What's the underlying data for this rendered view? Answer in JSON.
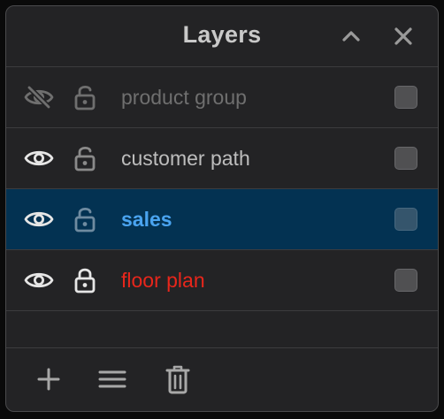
{
  "panel": {
    "title": "Layers",
    "header_icons": [
      "chevron-up-icon",
      "close-icon"
    ]
  },
  "layers": [
    {
      "name": "product group",
      "visible": false,
      "locked": false,
      "selected": false,
      "name_color": "#6f6f6f",
      "icon_color": "#6f6f6f"
    },
    {
      "name": "customer path",
      "visible": true,
      "locked": false,
      "selected": false,
      "name_color": "#bdbdbd",
      "icon_color": "#e6e6e6"
    },
    {
      "name": "sales",
      "visible": true,
      "locked": false,
      "selected": true,
      "name_color": "#4aa4f0",
      "icon_color": "#e6e6e6"
    },
    {
      "name": "floor plan",
      "visible": true,
      "locked": true,
      "selected": false,
      "name_color": "#e8261b",
      "icon_color": "#e6e6e6"
    }
  ],
  "footer": {
    "icons": [
      "plus-icon",
      "menu-icon",
      "trash-icon"
    ]
  },
  "colors": {
    "panel_bg": "#232325",
    "selected_row_bg": "#033252",
    "divider": "#3c3c3e",
    "icon_gray": "#9a9a9a"
  }
}
